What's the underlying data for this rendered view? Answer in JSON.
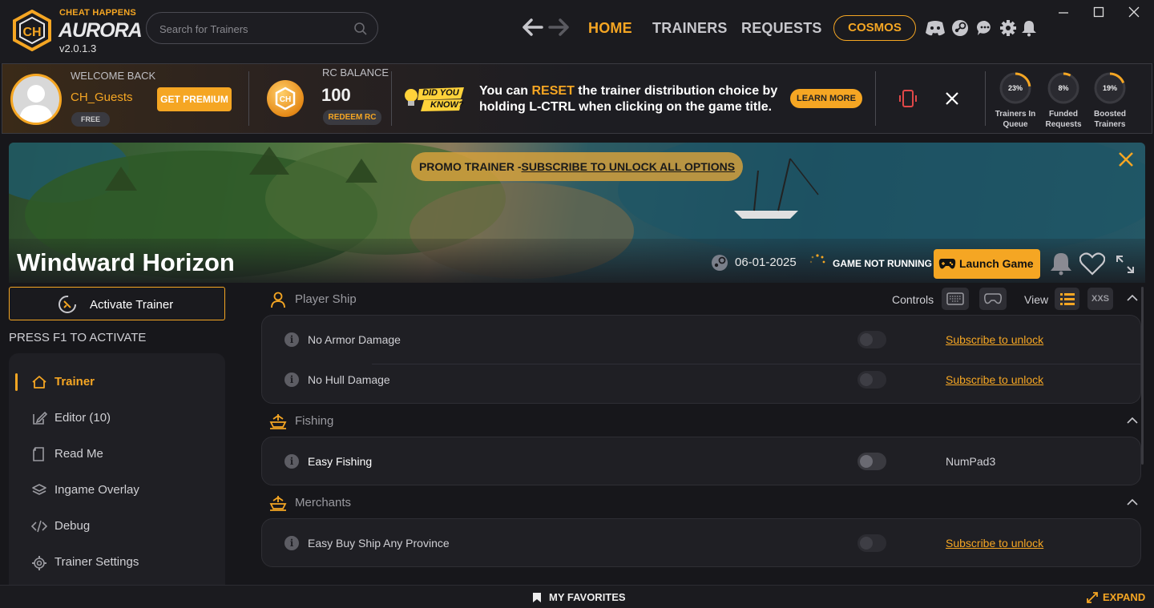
{
  "app": {
    "brand_small": "CHEAT HAPPENS",
    "brand_big": "AURORA",
    "version": "v2.0.1.3",
    "accent_color": "#f5a623"
  },
  "search": {
    "placeholder": "Search for Trainers"
  },
  "nav": {
    "home": "HOME",
    "trainers": "TRAINERS",
    "requests": "REQUESTS",
    "cosmos": "COSMOS"
  },
  "top_icons": [
    "discord-icon",
    "steam-icon",
    "chat-icon",
    "gear-icon",
    "bell-icon"
  ],
  "profile": {
    "welcome": "WELCOME BACK",
    "username": "CH_Guests",
    "tier": "FREE",
    "premium_button": "GET PREMIUM",
    "rc_label": "RC BALANCE",
    "rc_value": "100",
    "redeem_button": "REDEEM RC"
  },
  "tip": {
    "badge_line1": "DID YOU",
    "badge_line2": "KNOW?",
    "text_before": "You can ",
    "text_highlight": "RESET",
    "text_after": " the trainer distribution choice by holding L-CTRL when clicking on the game title.",
    "learn_more": "LEARN MORE"
  },
  "stats": [
    {
      "value": "23%",
      "label1": "Trainers In",
      "label2": "Queue",
      "fraction": 0.23
    },
    {
      "value": "8%",
      "label1": "Funded",
      "label2": "Requests",
      "fraction": 0.08
    },
    {
      "value": "19%",
      "label1": "Boosted",
      "label2": "Trainers",
      "fraction": 0.19
    }
  ],
  "banner": {
    "promo_prefix": "PROMO TRAINER -",
    "promo_link": "SUBSCRIBE TO UNLOCK ALL OPTIONS",
    "game_title": "Windward Horizon",
    "date": "06-01-2025",
    "status": "GAME NOT RUNNING",
    "launch": "Launch Game"
  },
  "sidebar": {
    "activate": "Activate Trainer",
    "hotkey_hint": "PRESS F1 TO ACTIVATE",
    "items": [
      {
        "label": "Trainer",
        "icon": "home-icon",
        "active": true
      },
      {
        "label": "Editor (10)",
        "icon": "edit-icon"
      },
      {
        "label": "Read Me",
        "icon": "document-icon"
      },
      {
        "label": "Ingame Overlay",
        "icon": "layers-icon"
      },
      {
        "label": "Debug",
        "icon": "code-icon"
      },
      {
        "label": "Trainer Settings",
        "icon": "gear-icon"
      }
    ]
  },
  "controls": {
    "controls_label": "Controls",
    "view_label": "View",
    "xxs": "XXS"
  },
  "sections": [
    {
      "title": "Player Ship",
      "icon": "user-icon",
      "options": [
        {
          "name": "No Armor Damage",
          "action": "Subscribe to unlock",
          "locked": true,
          "on": false
        },
        {
          "name": "No Hull Damage",
          "action": "Subscribe to unlock",
          "locked": true,
          "on": false
        }
      ]
    },
    {
      "title": "Fishing",
      "icon": "boat-icon",
      "options": [
        {
          "name": "Easy Fishing",
          "action": "NumPad3",
          "locked": false,
          "on": false
        }
      ]
    },
    {
      "title": "Merchants",
      "icon": "boat-icon",
      "options": [
        {
          "name": "Easy Buy Ship Any Province",
          "action": "Subscribe to unlock",
          "locked": true,
          "on": false
        }
      ]
    }
  ],
  "bottom": {
    "favorites": "MY FAVORITES",
    "expand": "EXPAND"
  }
}
